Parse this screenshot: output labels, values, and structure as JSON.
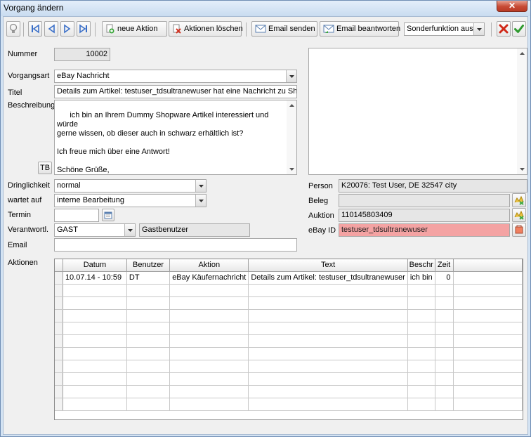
{
  "window": {
    "title": "Vorgang ändern",
    "close": "✕"
  },
  "toolbar": {
    "new_action": "neue Aktion",
    "delete_actions": "Aktionen löschen",
    "send_email": "Email senden",
    "reply_email": "Email beantworten",
    "special_function": "Sonderfunktion ausw"
  },
  "form": {
    "nummer_label": "Nummer",
    "nummer_value": "10002",
    "vorgangsart_label": "Vorgangsart",
    "vorgangsart_value": "eBay Nachricht",
    "titel_label": "Titel",
    "titel_value": "Details zum Artikel: testuser_tdsultranewuser hat eine Nachricht zu Shop",
    "beschreibung_label": "Beschreibung",
    "beschreibung_value": "ich bin an Ihrem Dummy Shopware Artikel interessiert und würde\ngerne wissen, ob dieser auch in schwarz erhältlich ist?\n\nIch freue mich über eine Antwort!\n\nSchöne Grüße,\nultranewuser",
    "tb_button": "TB",
    "dringlichkeit_label": "Dringlichkeit",
    "dringlichkeit_value": "normal",
    "wartet_label": "wartet auf",
    "wartet_value": "interne Bearbeitung",
    "termin_label": "Termin",
    "termin_value": "",
    "verantwortl_label": "Verantwortl.",
    "verantwortl_value": "GAST",
    "verantwortl_name": "Gastbenutzer",
    "email_label": "Email",
    "email_value": "",
    "person_label": "Person",
    "person_value": "K20076: Test User, DE 32547 city",
    "beleg_label": "Beleg",
    "beleg_value": "",
    "auktion_label": "Auktion",
    "auktion_value": "110145803409",
    "ebayid_label": "eBay ID",
    "ebayid_value": "testuser_tdsultranewuser",
    "aktionen_label": "Aktionen"
  },
  "grid": {
    "columns": [
      "Datum",
      "Benutzer",
      "Aktion",
      "Text",
      "Beschr",
      "Zeit"
    ],
    "rows": [
      [
        "10.07.14 - 10:59",
        "DT",
        "eBay Käufernachricht",
        "Details zum Artikel: testuser_tdsultranewuser",
        "ich bin",
        "0"
      ]
    ]
  },
  "colors": {
    "ebay_id_bg": "#f4a3a3",
    "window_frame": "#d4e3f3"
  }
}
